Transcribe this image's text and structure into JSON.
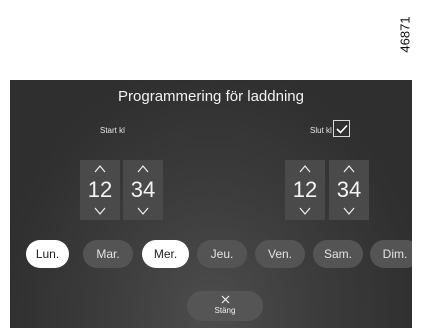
{
  "figure_number": "46871",
  "screen": {
    "title": "Programmering för laddning",
    "start": {
      "label": "Start kl",
      "hour": "12",
      "minute": "34"
    },
    "end": {
      "label": "Slut kl",
      "checked": true,
      "hour": "12",
      "minute": "34"
    },
    "days": [
      {
        "label": "Lun.",
        "selected": true
      },
      {
        "label": "Mar.",
        "selected": false
      },
      {
        "label": "Mer.",
        "selected": true
      },
      {
        "label": "Jeu.",
        "selected": false
      },
      {
        "label": "Ven.",
        "selected": false
      },
      {
        "label": "Sam.",
        "selected": false
      },
      {
        "label": "Dim.",
        "selected": false
      }
    ],
    "close_label": "Stäng"
  },
  "colors": {
    "screen_background": "#3b3b3b",
    "selected_day": "#ffffff",
    "unselected_day": "#545454",
    "text": "#f2f2f2"
  },
  "icons": {
    "up": "chevron-up-icon",
    "down": "chevron-down-icon",
    "check": "check-icon",
    "close": "close-icon"
  }
}
